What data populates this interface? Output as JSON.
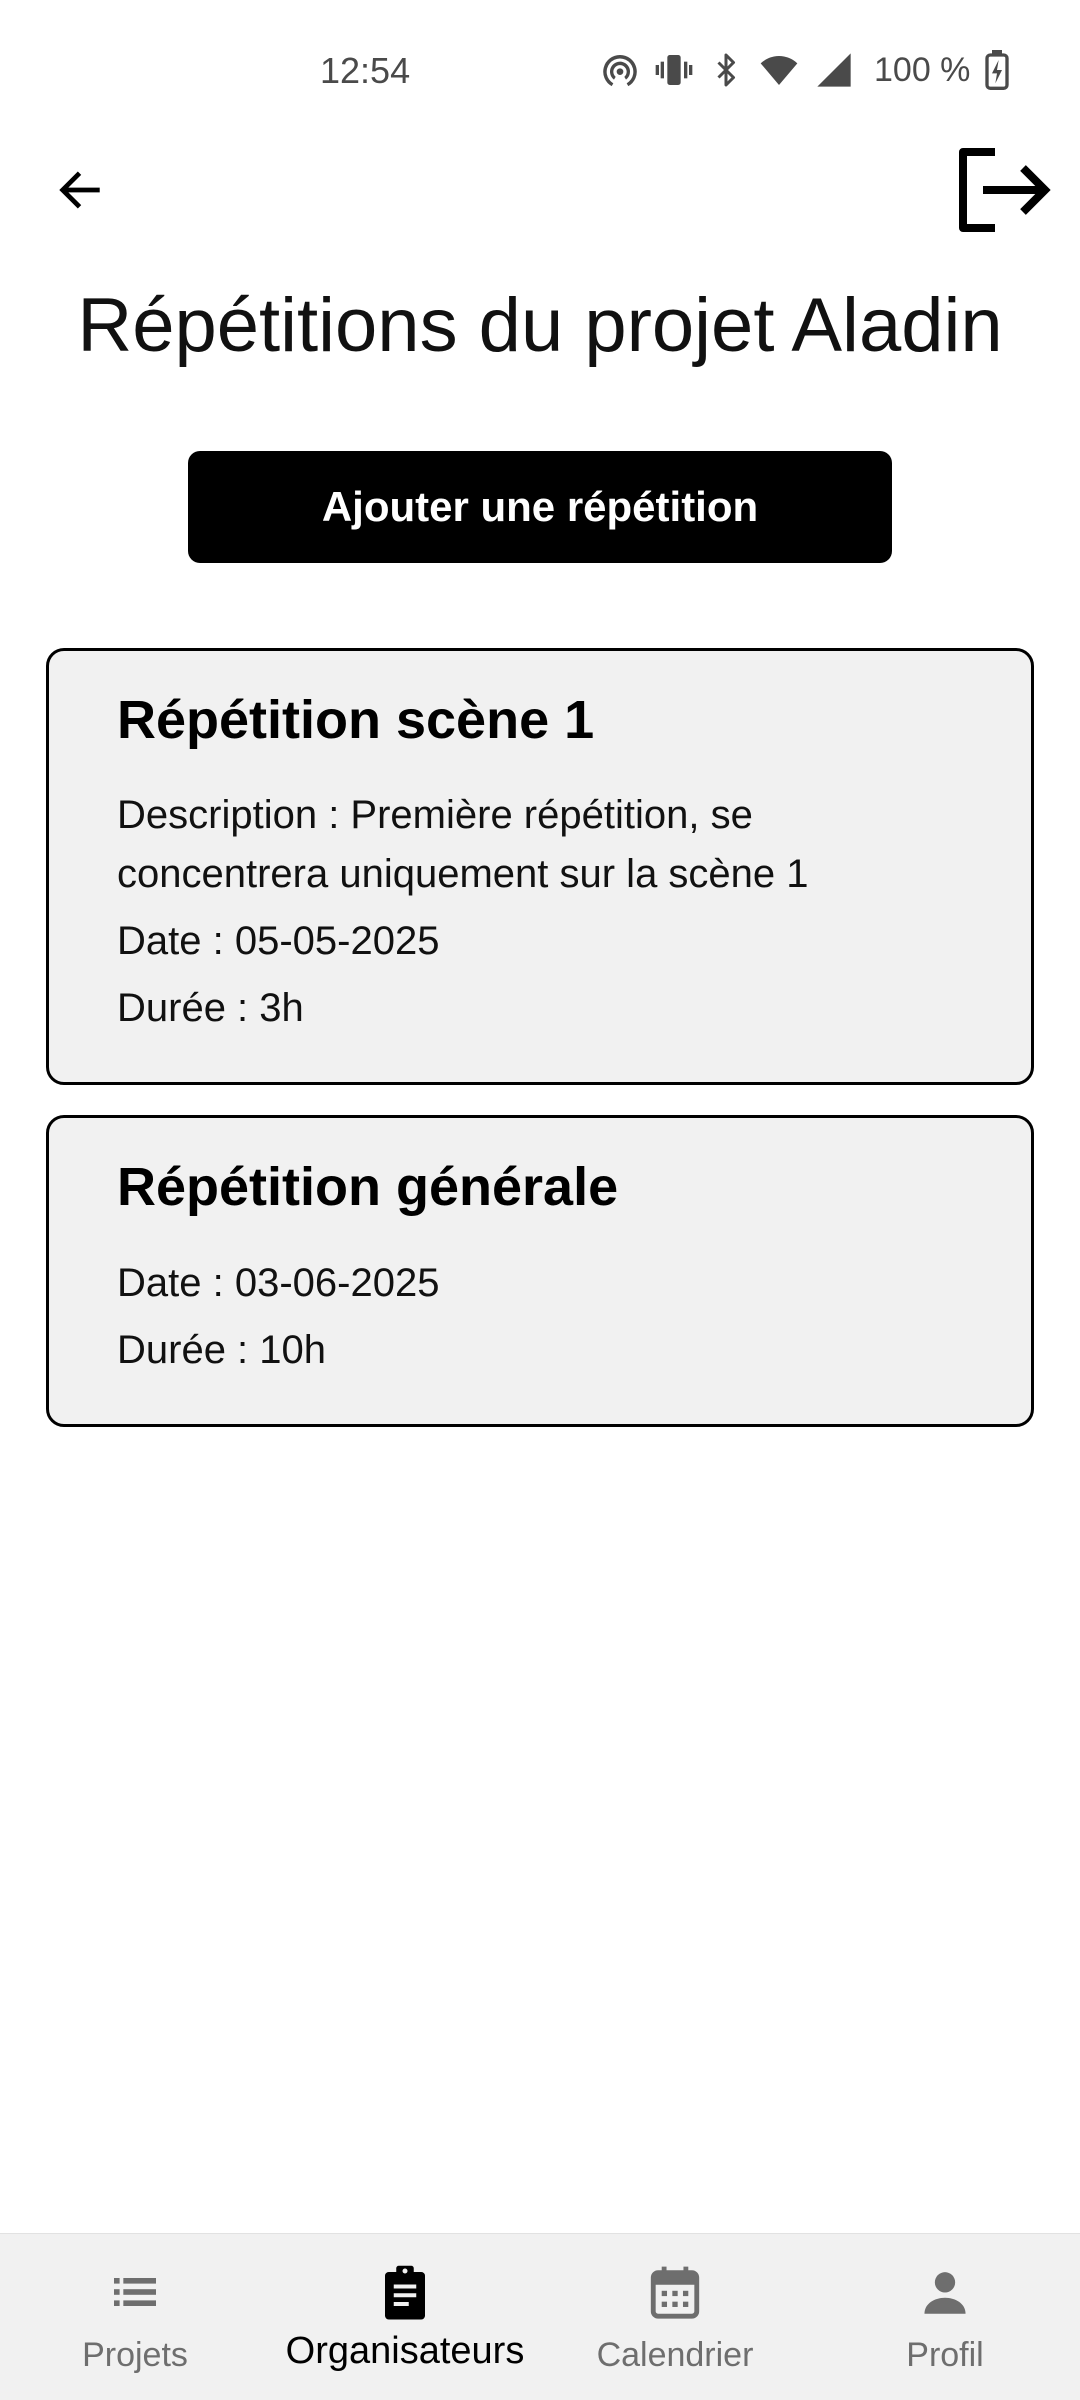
{
  "status_bar": {
    "time": "12:54",
    "battery": "100 %",
    "icons": [
      "hotspot-icon",
      "vibrate-icon",
      "bluetooth-icon",
      "wifi-icon",
      "signal-icon",
      "battery-charging-icon"
    ]
  },
  "app_bar": {
    "back_icon": "arrow-left-icon",
    "logout_icon": "logout-icon"
  },
  "page": {
    "title": "Répétitions du projet Aladin",
    "add_button_label": "Ajouter une répétition"
  },
  "rehearsals": [
    {
      "title": "Répétition scène 1",
      "description": "Description : Première répétition, se concentrera uniquement sur la scène 1",
      "date": "Date : 05-05-2025",
      "duration": "Durée : 3h"
    },
    {
      "title": "Répétition générale",
      "date": "Date : 03-06-2025",
      "duration": "Durée : 10h"
    }
  ],
  "bottom_nav": {
    "active": "Organisateurs",
    "items": [
      {
        "label": "Projets",
        "icon": "list-icon"
      },
      {
        "label": "Organisateurs",
        "icon": "clipboard-icon"
      },
      {
        "label": "Calendrier",
        "icon": "calendar-icon"
      },
      {
        "label": "Profil",
        "icon": "person-icon"
      }
    ]
  },
  "colors": {
    "primary": "#000000",
    "card_background": "#f1f1f1",
    "nav_background": "#f1f1f1",
    "inactive": "#6e6e6e"
  }
}
